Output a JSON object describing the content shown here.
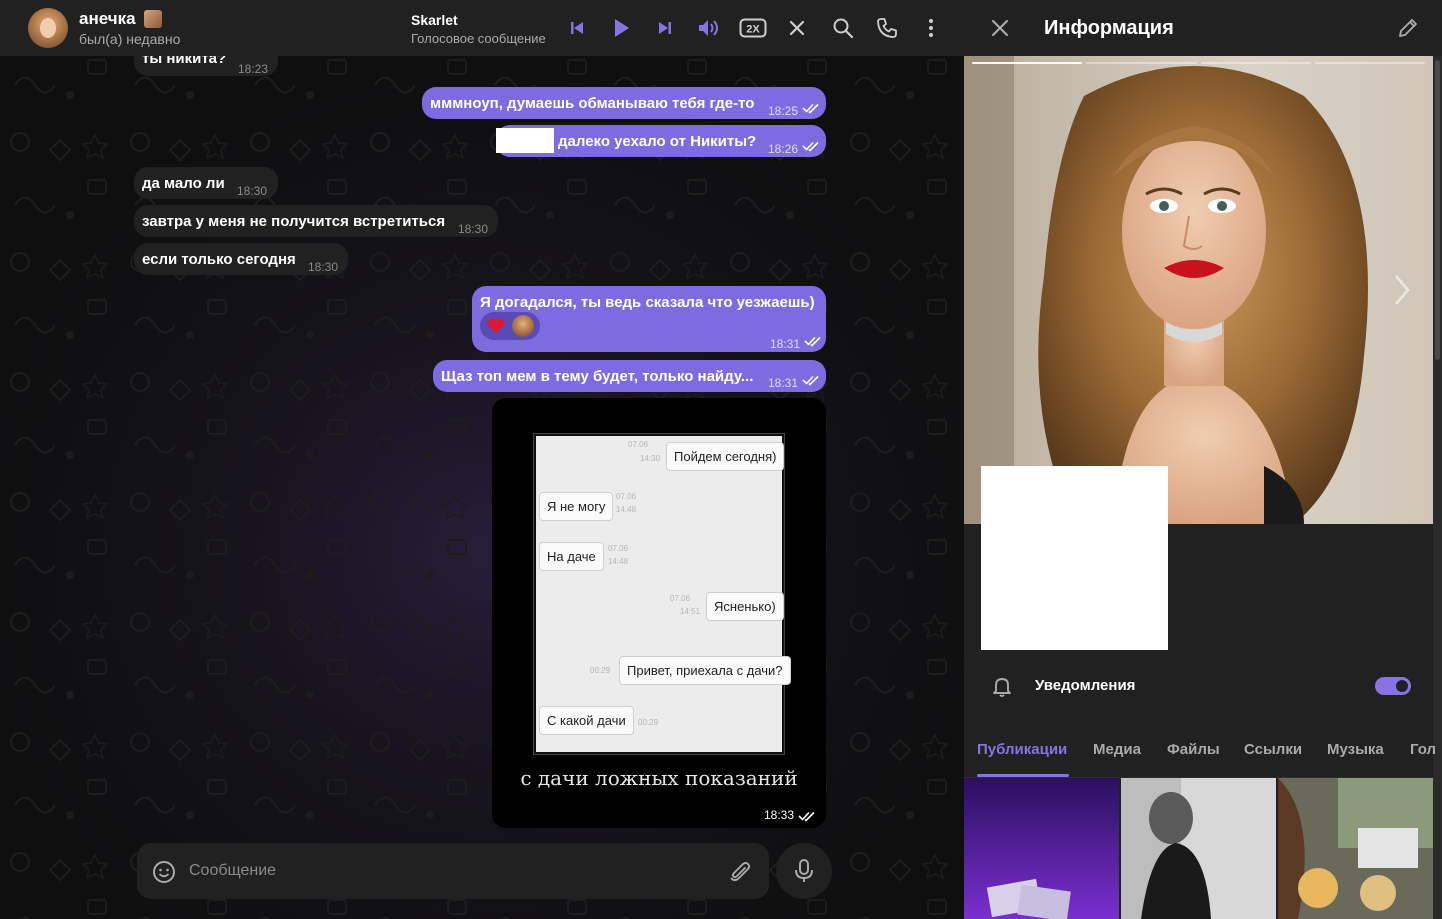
{
  "chat": {
    "peer_name": "анечка",
    "peer_status": "был(а) недавно",
    "player": {
      "title": "Skarlet",
      "subtitle": "Голосовое сообщение",
      "speed": "2X"
    },
    "messages": [
      {
        "dir": "in",
        "text": "ты никита?",
        "time": "18:23"
      },
      {
        "dir": "out",
        "text": "мммноуп, думаешь обманываю тебя где-то",
        "time": "18:25"
      },
      {
        "dir": "out",
        "text": "далеко уехало от Никиты?",
        "time": "18:26"
      },
      {
        "dir": "in",
        "text": "да мало ли",
        "time": "18:30"
      },
      {
        "dir": "in",
        "text": "завтра у меня не получится встретиться",
        "time": "18:30"
      },
      {
        "dir": "in",
        "text": "если только сегодня",
        "time": "18:30"
      },
      {
        "dir": "out",
        "text": "Я догадался, ты ведь сказала что уезжаешь)",
        "time": "18:31",
        "reaction": "heart"
      },
      {
        "dir": "out",
        "text": "Щаз топ мем в тему будет, только найду...",
        "time": "18:31"
      }
    ],
    "media_message": {
      "time": "18:33",
      "caption": "с дачи ложных показаний",
      "image_chat": [
        {
          "side": "right",
          "text": "Пойдем сегодня)",
          "time": "07.06\n14:30"
        },
        {
          "side": "left",
          "text": "Я не могу",
          "time": "07.06\n14:48"
        },
        {
          "side": "left",
          "text": "На даче",
          "time": "07.06\n14:48"
        },
        {
          "side": "right",
          "text": "Ясненько)",
          "time": "07.06\n14:51"
        },
        {
          "side": "right",
          "text": "Привет, приехала с дачи?",
          "time": "00:29"
        },
        {
          "side": "left",
          "text": "С какой дачи",
          "time": "00:29"
        }
      ]
    },
    "composer": {
      "placeholder": "Сообщение"
    }
  },
  "info": {
    "title": "Информация",
    "notifications_label": "Уведомления",
    "notifications_on": true,
    "tabs": [
      "Публикации",
      "Медиа",
      "Файлы",
      "Ссылки",
      "Музыка",
      "Гол"
    ],
    "active_tab": "Публикации"
  },
  "colors": {
    "accent": "#8774e1",
    "outgoing_bubble": "#7e6be0",
    "incoming_bubble": "#212121",
    "panel": "#212121"
  },
  "icons": [
    "prev-track-icon",
    "play-icon",
    "next-track-icon",
    "volume-icon",
    "speed-icon",
    "close-icon",
    "search-icon",
    "phone-icon",
    "more-icon",
    "edit-icon",
    "bell-icon",
    "emoji-icon",
    "attach-icon",
    "mic-icon"
  ]
}
